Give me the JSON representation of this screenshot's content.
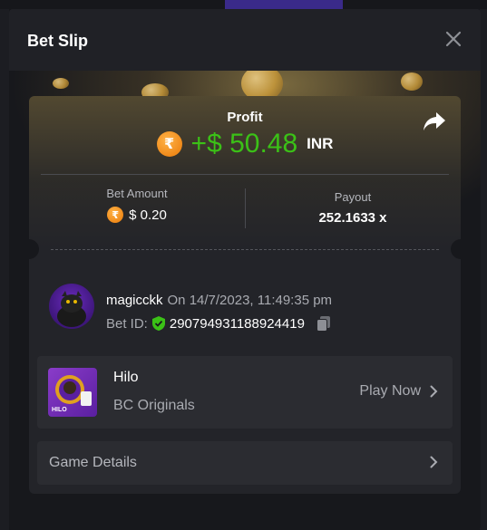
{
  "modal": {
    "title": "Bet Slip"
  },
  "profit": {
    "label": "Profit",
    "currency_symbol": "₹",
    "value": "+$ 50.48",
    "currency": "INR"
  },
  "stats": {
    "bet_amount_label": "Bet Amount",
    "bet_amount_value": "$ 0.20",
    "payout_label": "Payout",
    "payout_value": "252.1633 x"
  },
  "user": {
    "name": "magicckk",
    "timestamp": "On 14/7/2023, 11:49:35 pm",
    "bet_id_label": "Bet ID:",
    "bet_id": "290794931188924419"
  },
  "game": {
    "name": "Hilo",
    "provider": "BC Originals",
    "play_label": "Play Now",
    "thumb_text": "HILO"
  },
  "details": {
    "label": "Game Details"
  },
  "colors": {
    "profit_green": "#3bc117",
    "coin_orange": "#f08a1a",
    "shield_green": "#3bc117"
  }
}
